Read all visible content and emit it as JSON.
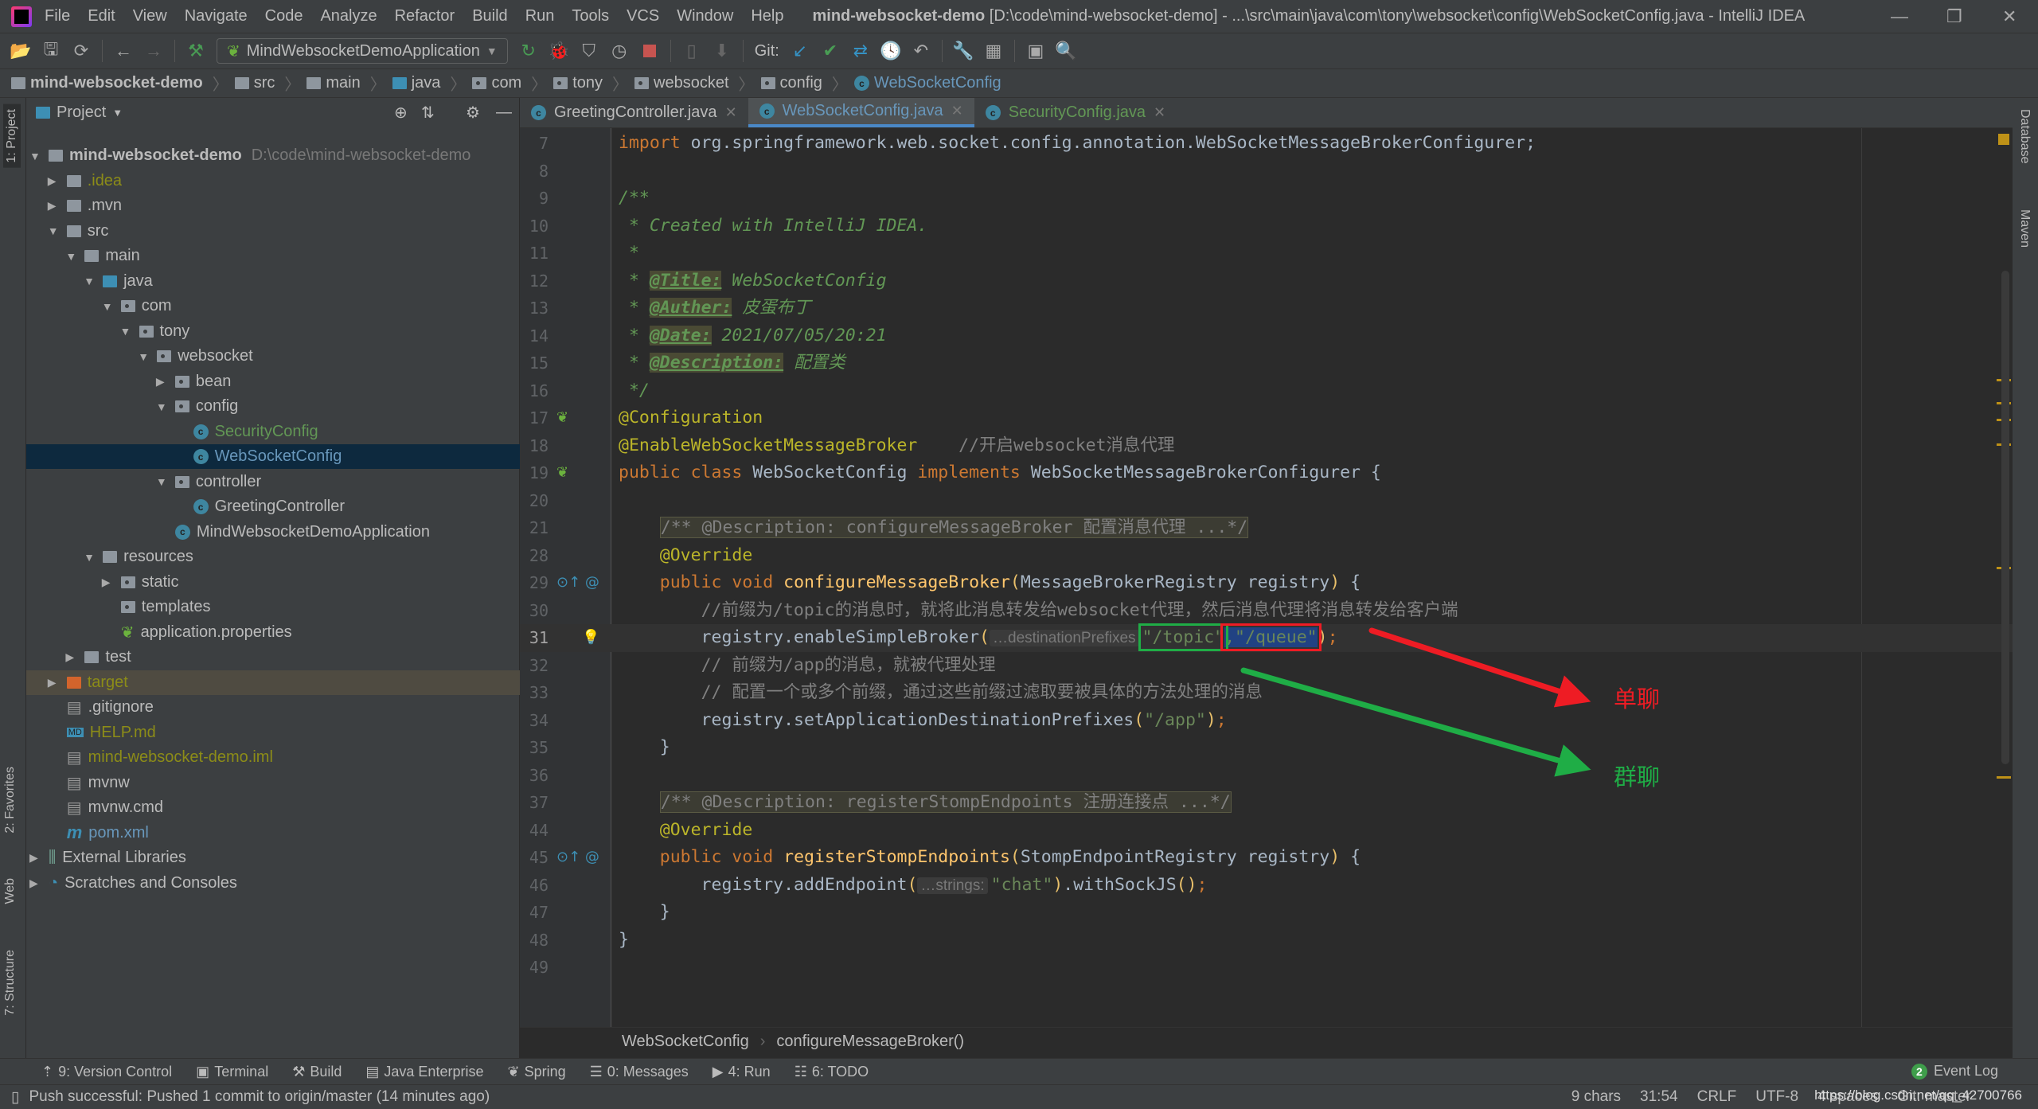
{
  "menu": {
    "items": [
      "File",
      "Edit",
      "View",
      "Navigate",
      "Code",
      "Analyze",
      "Refactor",
      "Build",
      "Run",
      "Tools",
      "VCS",
      "Window",
      "Help"
    ],
    "title_project": "mind-websocket-demo",
    "title_rest": "[D:\\code\\mind-websocket-demo] - ...\\src\\main\\java\\com\\tony\\websocket\\config\\WebSocketConfig.java - IntelliJ IDEA"
  },
  "toolbar": {
    "run_config": "MindWebsocketDemoApplication",
    "git_label": "Git:"
  },
  "nav": {
    "crumbs": [
      "mind-websocket-demo",
      "src",
      "main",
      "java",
      "com",
      "tony",
      "websocket",
      "config",
      "WebSocketConfig"
    ]
  },
  "left_stripe": [
    "1: Project",
    "2: Favorites",
    "Web",
    "7: Structure"
  ],
  "right_stripe": [
    "Database",
    "Maven"
  ],
  "project": {
    "title": "Project",
    "tree": [
      {
        "label": "mind-websocket-demo",
        "extra": "D:\\code\\mind-websocket-demo",
        "depth": 0,
        "arrow": "down",
        "icon": "module",
        "bold": true
      },
      {
        "label": ".idea",
        "depth": 1,
        "arrow": "right",
        "icon": "folder",
        "color": "#8c8c18"
      },
      {
        "label": ".mvn",
        "depth": 1,
        "arrow": "right",
        "icon": "folder"
      },
      {
        "label": "src",
        "depth": 1,
        "arrow": "down",
        "icon": "folder"
      },
      {
        "label": "main",
        "depth": 2,
        "arrow": "down",
        "icon": "folder"
      },
      {
        "label": "java",
        "depth": 3,
        "arrow": "down",
        "icon": "src"
      },
      {
        "label": "com",
        "depth": 4,
        "arrow": "down",
        "icon": "pkg"
      },
      {
        "label": "tony",
        "depth": 5,
        "arrow": "down",
        "icon": "pkg"
      },
      {
        "label": "websocket",
        "depth": 6,
        "arrow": "down",
        "icon": "pkg"
      },
      {
        "label": "bean",
        "depth": 7,
        "arrow": "right",
        "icon": "pkg"
      },
      {
        "label": "config",
        "depth": 7,
        "arrow": "down",
        "icon": "pkg"
      },
      {
        "label": "SecurityConfig",
        "depth": 8,
        "icon": "class",
        "color": "#629755"
      },
      {
        "label": "WebSocketConfig",
        "depth": 8,
        "icon": "class",
        "color": "#6897bb",
        "selected": true
      },
      {
        "label": "controller",
        "depth": 7,
        "arrow": "down",
        "icon": "pkg"
      },
      {
        "label": "GreetingController",
        "depth": 8,
        "icon": "class"
      },
      {
        "label": "MindWebsocketDemoApplication",
        "depth": 7,
        "icon": "springclass"
      },
      {
        "label": "resources",
        "depth": 3,
        "arrow": "down",
        "icon": "folder"
      },
      {
        "label": "static",
        "depth": 4,
        "arrow": "right",
        "icon": "pkg"
      },
      {
        "label": "templates",
        "depth": 4,
        "icon": "pkg"
      },
      {
        "label": "application.properties",
        "depth": 4,
        "icon": "spring"
      },
      {
        "label": "test",
        "depth": 2,
        "arrow": "right",
        "icon": "folder"
      },
      {
        "label": "target",
        "depth": 1,
        "arrow": "right",
        "icon": "target",
        "color": "#8c8c18",
        "excluded": true
      },
      {
        "label": ".gitignore",
        "depth": 1,
        "icon": "file"
      },
      {
        "label": "HELP.md",
        "depth": 1,
        "icon": "md",
        "color": "#8c8c18"
      },
      {
        "label": "mind-websocket-demo.iml",
        "depth": 1,
        "icon": "file",
        "color": "#8c8c18"
      },
      {
        "label": "mvnw",
        "depth": 1,
        "icon": "file"
      },
      {
        "label": "mvnw.cmd",
        "depth": 1,
        "icon": "file"
      },
      {
        "label": "pom.xml",
        "depth": 1,
        "icon": "maven",
        "color": "#6897bb"
      },
      {
        "label": "External Libraries",
        "depth": 0,
        "arrow": "right",
        "icon": "libs"
      },
      {
        "label": "Scratches and Consoles",
        "depth": 0,
        "arrow": "right",
        "icon": "scratch"
      }
    ]
  },
  "tabs": [
    {
      "label": "GreetingController.java",
      "active": false,
      "color": "#bbbbbb"
    },
    {
      "label": "WebSocketConfig.java",
      "active": true,
      "color": "#6897bb"
    },
    {
      "label": "SecurityConfig.java",
      "active": false,
      "color": "#629755"
    }
  ],
  "code": [
    {
      "n": "7",
      "t": [
        [
          "kw",
          "import"
        ],
        [
          "df",
          " org.springframework.web.socket.config.annotation.WebSocketMessageBrokerConfigurer;"
        ]
      ]
    },
    {
      "n": "8",
      "t": []
    },
    {
      "n": "9",
      "t": [
        [
          "doc",
          "/**"
        ]
      ]
    },
    {
      "n": "10",
      "t": [
        [
          "doc",
          " * Created with IntelliJ IDEA."
        ]
      ]
    },
    {
      "n": "11",
      "t": [
        [
          "doc",
          " *"
        ]
      ]
    },
    {
      "n": "12",
      "t": [
        [
          "doc",
          " * "
        ],
        [
          "dtag",
          "@Title:"
        ],
        [
          "doc",
          " WebSocketConfig"
        ]
      ]
    },
    {
      "n": "13",
      "t": [
        [
          "doc",
          " * "
        ],
        [
          "dtag",
          "@Auther:"
        ],
        [
          "doc",
          " 皮蛋布丁"
        ]
      ]
    },
    {
      "n": "14",
      "t": [
        [
          "doc",
          " * "
        ],
        [
          "dtag",
          "@Date:"
        ],
        [
          "doc",
          " 2021/07/05/20:21"
        ]
      ]
    },
    {
      "n": "15",
      "t": [
        [
          "doc",
          " * "
        ],
        [
          "dtag",
          "@Description:"
        ],
        [
          "doc",
          " 配置类"
        ]
      ]
    },
    {
      "n": "16",
      "t": [
        [
          "doc",
          " */"
        ]
      ]
    },
    {
      "n": "17",
      "g": "bean",
      "t": [
        [
          "ann",
          "@Configuration"
        ]
      ]
    },
    {
      "n": "18",
      "t": [
        [
          "ann",
          "@EnableWebSocketMessageBroker"
        ],
        [
          "cm",
          "    //开启websocket消息代理"
        ]
      ]
    },
    {
      "n": "19",
      "g": "bean",
      "t": [
        [
          "kw",
          "public class "
        ],
        [
          "df",
          "WebSocketConfig "
        ],
        [
          "kw",
          "implements "
        ],
        [
          "df",
          "WebSocketMessageBrokerConfigurer {"
        ]
      ]
    },
    {
      "n": "20",
      "t": []
    },
    {
      "n": "21",
      "t": [
        [
          "df",
          "    "
        ],
        [
          "fold",
          "/** @Description: configureMessageBroker 配置消息代理 ...*/"
        ]
      ]
    },
    {
      "n": "28",
      "t": [
        [
          "df",
          "    "
        ],
        [
          "ann",
          "@Override"
        ]
      ]
    },
    {
      "n": "29",
      "g": "override",
      "t": [
        [
          "df",
          "    "
        ],
        [
          "kw",
          "public void "
        ],
        [
          "fn",
          "configureMessageBroker"
        ],
        [
          "par",
          "("
        ],
        [
          "df",
          "MessageBrokerRegistry registry"
        ],
        [
          "par",
          ")"
        ],
        [
          "df",
          " {"
        ]
      ]
    },
    {
      "n": "30",
      "t": [
        [
          "df",
          "        "
        ],
        [
          "cm",
          "//前缀为/topic的消息时，就将此消息转发给websocket代理，然后消息代理将消息转发给客户端"
        ]
      ]
    },
    {
      "n": "31",
      "g": "bulb",
      "cur": true,
      "t": [
        [
          "df",
          "        registry.enableSimpleBroker"
        ],
        [
          "par",
          "("
        ],
        [
          "hint",
          "…destinationPrefixes"
        ],
        [
          "str",
          "\"/topic\"",
          "box-green"
        ],
        [
          "df",
          ",\"/queue\"",
          "box-red"
        ],
        [
          "par",
          ")"
        ],
        [
          "kw",
          ";"
        ]
      ]
    },
    {
      "n": "32",
      "t": [
        [
          "df",
          "        "
        ],
        [
          "cm",
          "// 前缀为/app的消息，就被代理处理"
        ]
      ]
    },
    {
      "n": "33",
      "t": [
        [
          "df",
          "        "
        ],
        [
          "cm",
          "// 配置一个或多个前缀，通过这些前缀过滤取要被具体的方法处理的消息"
        ]
      ]
    },
    {
      "n": "34",
      "t": [
        [
          "df",
          "        registry.setApplicationDestinationPrefixes"
        ],
        [
          "par",
          "("
        ],
        [
          "str",
          "\"/app\""
        ],
        [
          "par",
          ")"
        ],
        [
          "kw",
          ";"
        ]
      ]
    },
    {
      "n": "35",
      "t": [
        [
          "df",
          "    }"
        ]
      ]
    },
    {
      "n": "36",
      "t": []
    },
    {
      "n": "37",
      "t": [
        [
          "df",
          "    "
        ],
        [
          "fold",
          "/** @Description: registerStompEndpoints 注册连接点 ...*/"
        ]
      ]
    },
    {
      "n": "44",
      "t": [
        [
          "df",
          "    "
        ],
        [
          "ann",
          "@Override"
        ]
      ]
    },
    {
      "n": "45",
      "g": "override",
      "t": [
        [
          "df",
          "    "
        ],
        [
          "kw",
          "public void "
        ],
        [
          "fn",
          "registerStompEndpoints"
        ],
        [
          "par",
          "("
        ],
        [
          "df",
          "StompEndpointRegistry registry"
        ],
        [
          "par",
          ")"
        ],
        [
          "df",
          " {"
        ]
      ]
    },
    {
      "n": "46",
      "t": [
        [
          "df",
          "        registry.addEndpoint"
        ],
        [
          "par",
          "("
        ],
        [
          "hint",
          "…strings:"
        ],
        [
          "str",
          "\"chat\""
        ],
        [
          "par",
          ")"
        ],
        [
          "df",
          ".withSockJS"
        ],
        [
          "par",
          "()"
        ],
        [
          "kw",
          ";"
        ]
      ]
    },
    {
      "n": "47",
      "t": [
        [
          "df",
          "    }"
        ]
      ]
    },
    {
      "n": "48",
      "t": [
        [
          "df",
          "}"
        ]
      ]
    },
    {
      "n": "49",
      "t": []
    }
  ],
  "annotations": {
    "single_chat": "单聊",
    "group_chat": "群聊",
    "single_color": "#ee1c24",
    "group_color": "#1fad46"
  },
  "editor_breadcrumb": [
    "WebSocketConfig",
    "configureMessageBroker()"
  ],
  "tool_windows": [
    "9: Version Control",
    "Terminal",
    "Build",
    "Java Enterprise",
    "Spring",
    "0: Messages",
    "4: Run",
    "6: TODO"
  ],
  "event_log": {
    "count": "2",
    "label": "Event Log"
  },
  "status": {
    "message": "Push successful: Pushed 1 commit to origin/master (14 minutes ago)",
    "chars": "9 chars",
    "position": "31:54",
    "line_sep": "CRLF",
    "encoding": "UTF-8",
    "indent": "4 spaces",
    "git": "Git: master",
    "watermark": "https://blog.csdn.net/qq_42700766"
  },
  "colors": {
    "keyword": "#cc7832",
    "annotation": "#bbb529",
    "string": "#6a8759",
    "doc": "#629755",
    "method": "#ffc66d",
    "accent": "#4a88c7"
  }
}
